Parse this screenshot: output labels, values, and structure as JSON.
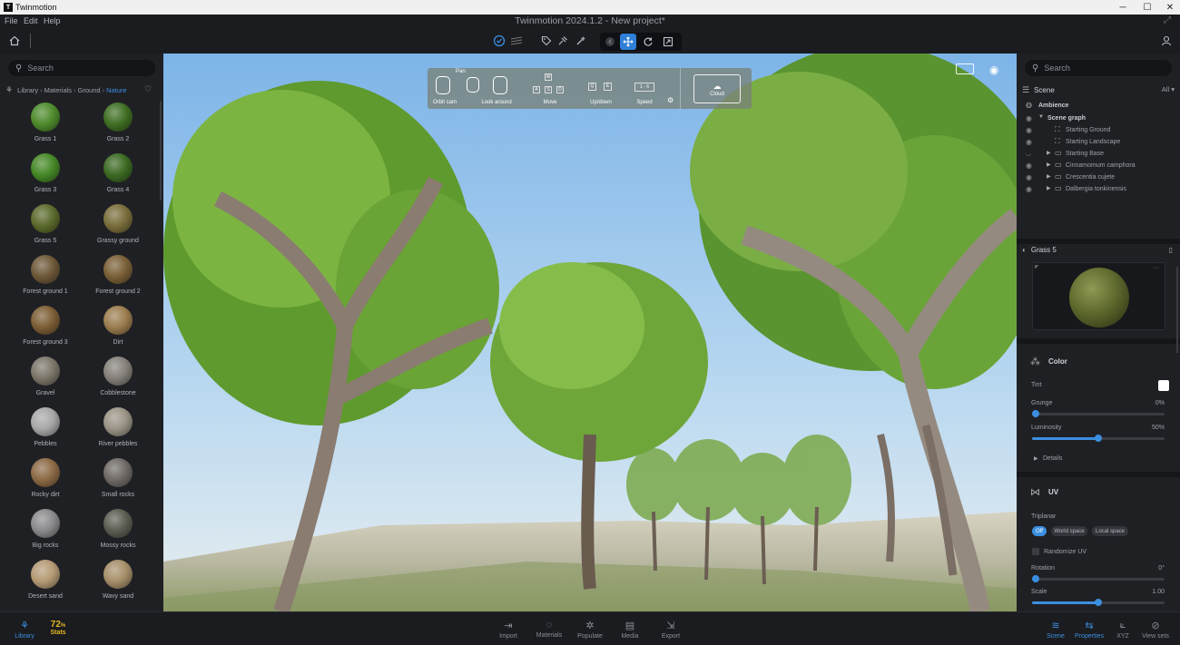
{
  "titlebar": {
    "app_name": "Twinmotion",
    "minimize": "─",
    "maximize": "☐",
    "close": "✕"
  },
  "menu": {
    "file": "File",
    "edit": "Edit",
    "help": "Help",
    "document_title": "Twinmotion 2024.1.2 - New project*"
  },
  "colors": {
    "accent": "#3b8fe0",
    "stats_yellow": "#e4b822",
    "panel_bg": "#1f2024"
  },
  "library": {
    "search_placeholder": "Search",
    "breadcrumb": [
      "Library",
      "Materials",
      "Ground",
      "Nature"
    ],
    "items": [
      {
        "label": "Grass 1",
        "color": "#4e8b2c"
      },
      {
        "label": "Grass 2",
        "color": "#3f6f24"
      },
      {
        "label": "Grass 3",
        "color": "#468827"
      },
      {
        "label": "Grass 4",
        "color": "#3c6a23"
      },
      {
        "label": "Grass 5",
        "color": "#5b6a2c"
      },
      {
        "label": "Grassy ground",
        "color": "#7a6e3c"
      },
      {
        "label": "Forest ground 1",
        "color": "#6e5838"
      },
      {
        "label": "Forest ground 2",
        "color": "#7a6037"
      },
      {
        "label": "Forest ground 3",
        "color": "#7c5e35"
      },
      {
        "label": "Dirt",
        "color": "#9b7d4f"
      },
      {
        "label": "Gravel",
        "color": "#7c766a"
      },
      {
        "label": "Cobblestone",
        "color": "#85807a"
      },
      {
        "label": "Pebbles",
        "color": "#a7a7a7"
      },
      {
        "label": "River pebbles",
        "color": "#9a9386"
      },
      {
        "label": "Rocky dirt",
        "color": "#8c6a45"
      },
      {
        "label": "Small rocks",
        "color": "#6f6a66"
      },
      {
        "label": "Big rocks",
        "color": "#8a8a8c"
      },
      {
        "label": "Mossy rocks",
        "color": "#5c5e52"
      },
      {
        "label": "Desert sand",
        "color": "#b49a74"
      },
      {
        "label": "Wavy sand",
        "color": "#a68f6a"
      }
    ]
  },
  "nav_hud": {
    "pan": "Pan",
    "orbit": "Orbit cam",
    "look": "Look around",
    "move": "Move",
    "updown": "Up/down",
    "speed": "Speed",
    "speed_keys": "1 - 6",
    "move_keys": [
      "W",
      "A",
      "S",
      "D"
    ],
    "updown_keys": [
      "Q",
      "E"
    ],
    "cloud": "Cloud"
  },
  "scene": {
    "search_placeholder": "Search",
    "title": "Scene",
    "filter": "All",
    "ambience": "Ambience",
    "scene_graph": "Scene graph",
    "items": [
      {
        "label": "Starting Ground"
      },
      {
        "label": "Starting Landscape"
      },
      {
        "label": "Starting Base"
      },
      {
        "label": "Cinnamomum camphora"
      },
      {
        "label": "Crescentia cujete"
      },
      {
        "label": "Dalbergia tonkinensis"
      }
    ]
  },
  "material": {
    "name": "Grass 5",
    "more": "···",
    "color_section": "Color",
    "tint_label": "Tint",
    "grunge_label": "Grunge",
    "grunge_value": "0%",
    "grunge_level": 0,
    "luminosity_label": "Luminosity",
    "luminosity_value": "50%",
    "luminosity_level": 0.5,
    "details_label": "Details",
    "uv_section": "UV",
    "triplanar_label": "Triplanar",
    "triplanar_options": [
      "Off",
      "World space",
      "Local space"
    ],
    "randomize_label": "Randomize UV",
    "rotation_label": "Rotation",
    "rotation_value": "0°",
    "rotation_level": 0,
    "scale_label": "Scale",
    "scale_value": "1.00",
    "scale_level": 0.5
  },
  "bottom": {
    "library": "Library",
    "stats_pct": "72",
    "stats_unit": "%",
    "stats": "Stats",
    "import": "Import",
    "materials": "Materials",
    "populate": "Populate",
    "media": "Media",
    "export": "Export",
    "scene": "Scene",
    "properties": "Properties",
    "xyz": "XYZ",
    "view_sets": "View sets"
  }
}
